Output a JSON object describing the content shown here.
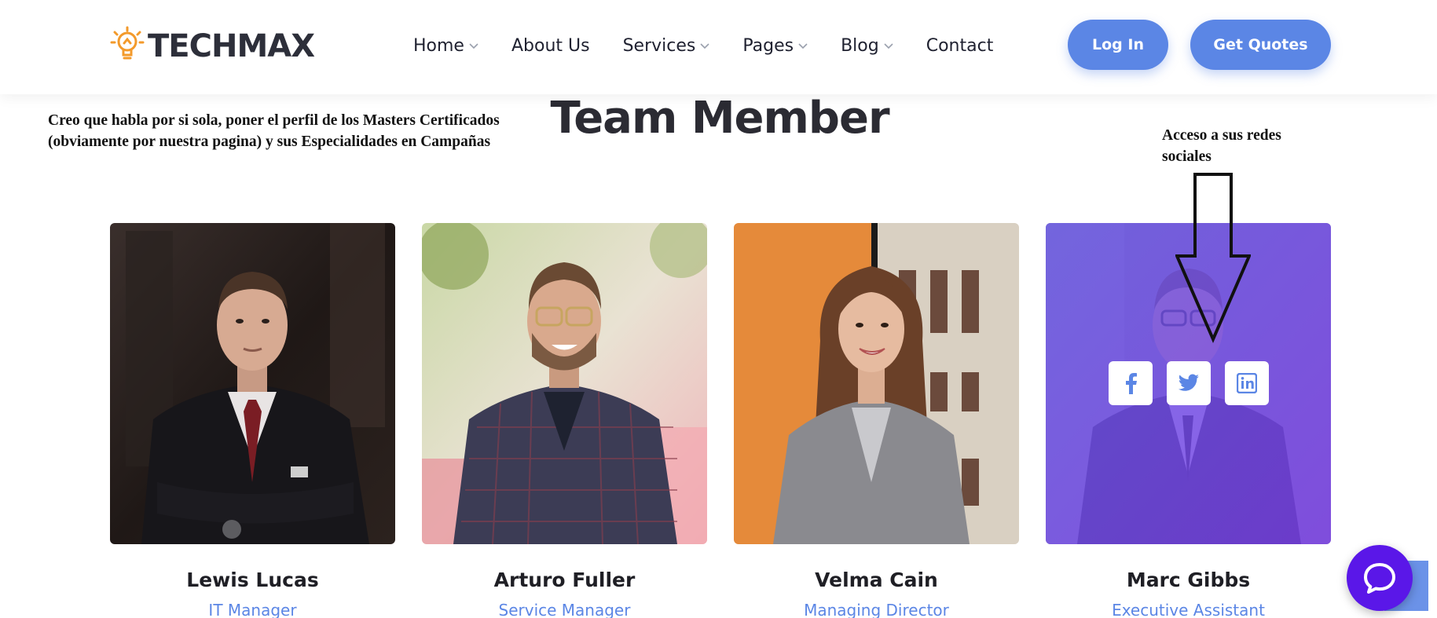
{
  "header": {
    "logo_text": "TECHMAX",
    "nav": [
      {
        "label": "Home",
        "has_dropdown": true
      },
      {
        "label": "About Us",
        "has_dropdown": false
      },
      {
        "label": "Services",
        "has_dropdown": true
      },
      {
        "label": "Pages",
        "has_dropdown": true
      },
      {
        "label": "Blog",
        "has_dropdown": true
      },
      {
        "label": "Contact",
        "has_dropdown": false
      }
    ],
    "login_label": "Log In",
    "quote_label": "Get Quotes"
  },
  "annotations": {
    "left": "Creo que habla por si sola, poner el perfil de los Masters Certificados (obviamente por nuestra pagina) y sus Especialidades en Campañas",
    "right": "Acceso a sus redes sociales"
  },
  "section": {
    "title": "Team Member"
  },
  "team": [
    {
      "name": "Lewis Lucas",
      "role": "IT Manager"
    },
    {
      "name": "Arturo Fuller",
      "role": "Service Manager"
    },
    {
      "name": "Velma Cain",
      "role": "Managing Director"
    },
    {
      "name": "Marc Gibbs",
      "role": "Executive Assistant"
    }
  ],
  "social_icons": [
    "facebook-icon",
    "twitter-icon",
    "linkedin-icon"
  ],
  "colors": {
    "accent": "#5b86e5",
    "overlay": "#6a4cf0",
    "chat": "#5a17e8"
  }
}
